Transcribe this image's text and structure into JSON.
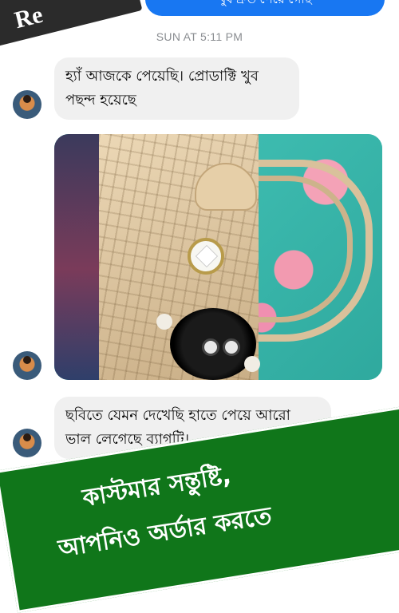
{
  "overlay_top": {
    "badge_text": "Re"
  },
  "sent_message": {
    "text": "খুব দ্রুত পেয়ে গেছি"
  },
  "timestamp": "SUN AT 5:11 PM",
  "messages": [
    {
      "text": "হ্যাঁ আজকে পেয়েছি। প্রোডাক্টি খুব পছন্দ হয়েছে"
    },
    {
      "text": "ছবিতে যেমন দেখেছি হাতে পেয়ে আরো ভাল লেগেছে ব্যাগটি।"
    }
  ],
  "promo_banner": {
    "line1": "কাস্টমার সন্তুষ্টি,",
    "line2": "আপনিও  অর্ডার করতে"
  },
  "colors": {
    "sent_bubble": "#1877f2",
    "received_bubble": "#f0f0f0",
    "promo_banner": "#10761a"
  }
}
